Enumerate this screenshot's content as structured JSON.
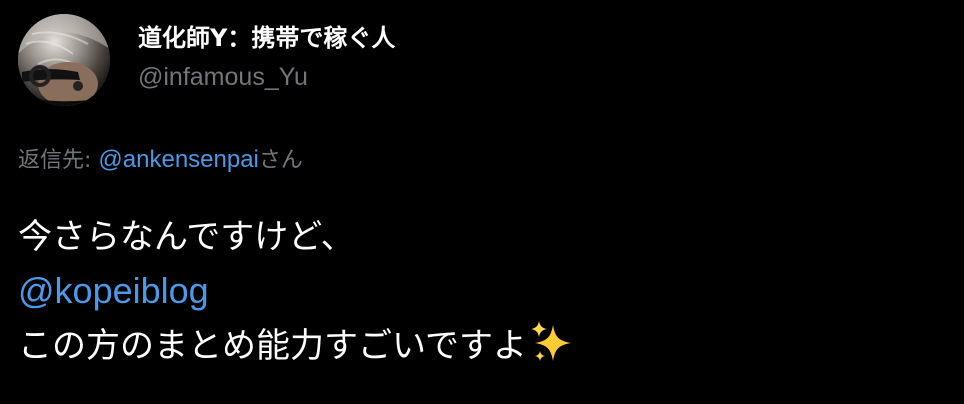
{
  "author": {
    "display_name": "道化師Y：携帯で稼ぐ人",
    "handle": "@infamous_Yu",
    "avatar_icon": "avatar-photo"
  },
  "reply": {
    "prefix": "返信先: ",
    "mention": "@ankensenpai",
    "suffix": "さん"
  },
  "body": {
    "line1": "今さらなんですけど、",
    "mention": "@kopeiblog",
    "line3": "この方のまとめ能力すごいですよ",
    "emoji_icon": "sparkles-icon"
  },
  "colors": {
    "background": "#000000",
    "text_primary": "#ffffff",
    "text_secondary": "#71767b",
    "link": "#4b99e8",
    "sparkle": "#ffcc33"
  }
}
